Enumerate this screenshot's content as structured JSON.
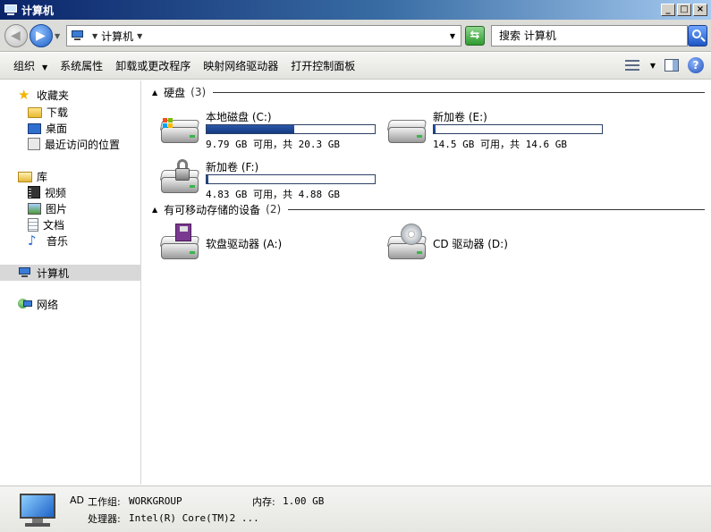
{
  "window": {
    "title": "计算机",
    "buttons": [
      "_",
      "□",
      "×"
    ]
  },
  "address": {
    "crumb": "计算机",
    "search_placeholder": "搜索 计算机"
  },
  "toolbar": {
    "items": [
      "组织",
      "系统属性",
      "卸载或更改程序",
      "映射网络驱动器",
      "打开控制面板"
    ],
    "help": "?"
  },
  "nav": {
    "favorites": {
      "label": "收藏夹",
      "children": [
        "下载",
        "桌面",
        "最近访问的位置"
      ]
    },
    "libraries": {
      "label": "库",
      "children": [
        "视频",
        "图片",
        "文档",
        "音乐"
      ]
    },
    "computer": "计算机",
    "network": "网络"
  },
  "groups": {
    "hard_disks": {
      "label": "硬盘",
      "count": "(3)"
    },
    "removable": {
      "label": "有可移动存储的设备",
      "count": "(2)"
    }
  },
  "drives": [
    {
      "name": "本地磁盘 (C:)",
      "size": "9.79 GB 可用，共 20.3 GB",
      "used_fraction": 0.52,
      "icon": "windows-hard-disk-icon"
    },
    {
      "name": "新加卷 (E:)",
      "size": "14.5 GB 可用，共 14.6 GB",
      "used_fraction": 0.01,
      "icon": "hard-disk-icon"
    },
    {
      "name": "新加卷 (F:)",
      "size": "4.83 GB 可用，共 4.88 GB",
      "used_fraction": 0.01,
      "icon": "locked-drive-icon"
    }
  ],
  "removable_devices": [
    {
      "name": "软盘驱动器 (A:)",
      "icon": "floppy-drive-icon"
    },
    {
      "name": "CD 驱动器 (D:)",
      "icon": "cd-drive-icon"
    }
  ],
  "details": {
    "name": "AD",
    "workgroup_label": "工作组:",
    "workgroup": "WORKGROUP",
    "memory_label": "内存:",
    "memory": "1.00 GB",
    "cpu_label": "处理器:",
    "cpu": "Intel(R) Core(TM)2 ..."
  },
  "colors": {
    "title_gradient_start": "#0a246a",
    "drive_fill": "#1e4a96"
  }
}
